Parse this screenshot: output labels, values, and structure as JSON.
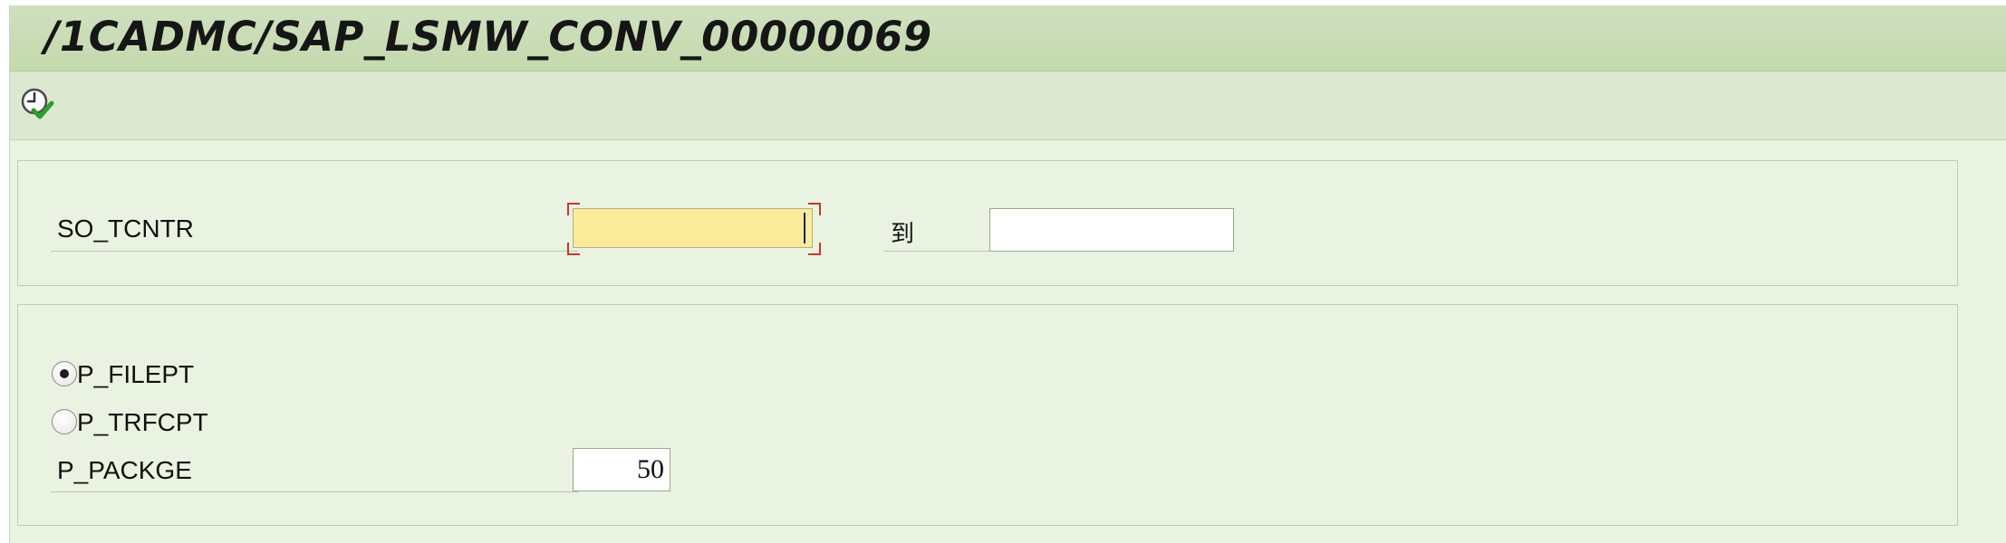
{
  "window": {
    "title": "/1CADMC/SAP_LSMW_CONV_00000069"
  },
  "toolbar": {
    "execute_icon": "execute-clock-check-icon"
  },
  "selection": {
    "so_tcntr": {
      "label": "SO_TCNTR",
      "low_value": "",
      "to_label": "到",
      "high_value": ""
    }
  },
  "options": {
    "p_filept": {
      "label": "P_FILEPT",
      "selected": true
    },
    "p_trfcpt": {
      "label": "P_TRFCPT",
      "selected": false
    },
    "p_packge": {
      "label": "P_PACKGE",
      "value": "50"
    }
  },
  "colors": {
    "title_bar": "#c4d9ad",
    "toolbar": "#dde8d1",
    "background": "#eaf2e0",
    "focused_input": "#fbec9c",
    "focus_corner": "#c0392b"
  }
}
